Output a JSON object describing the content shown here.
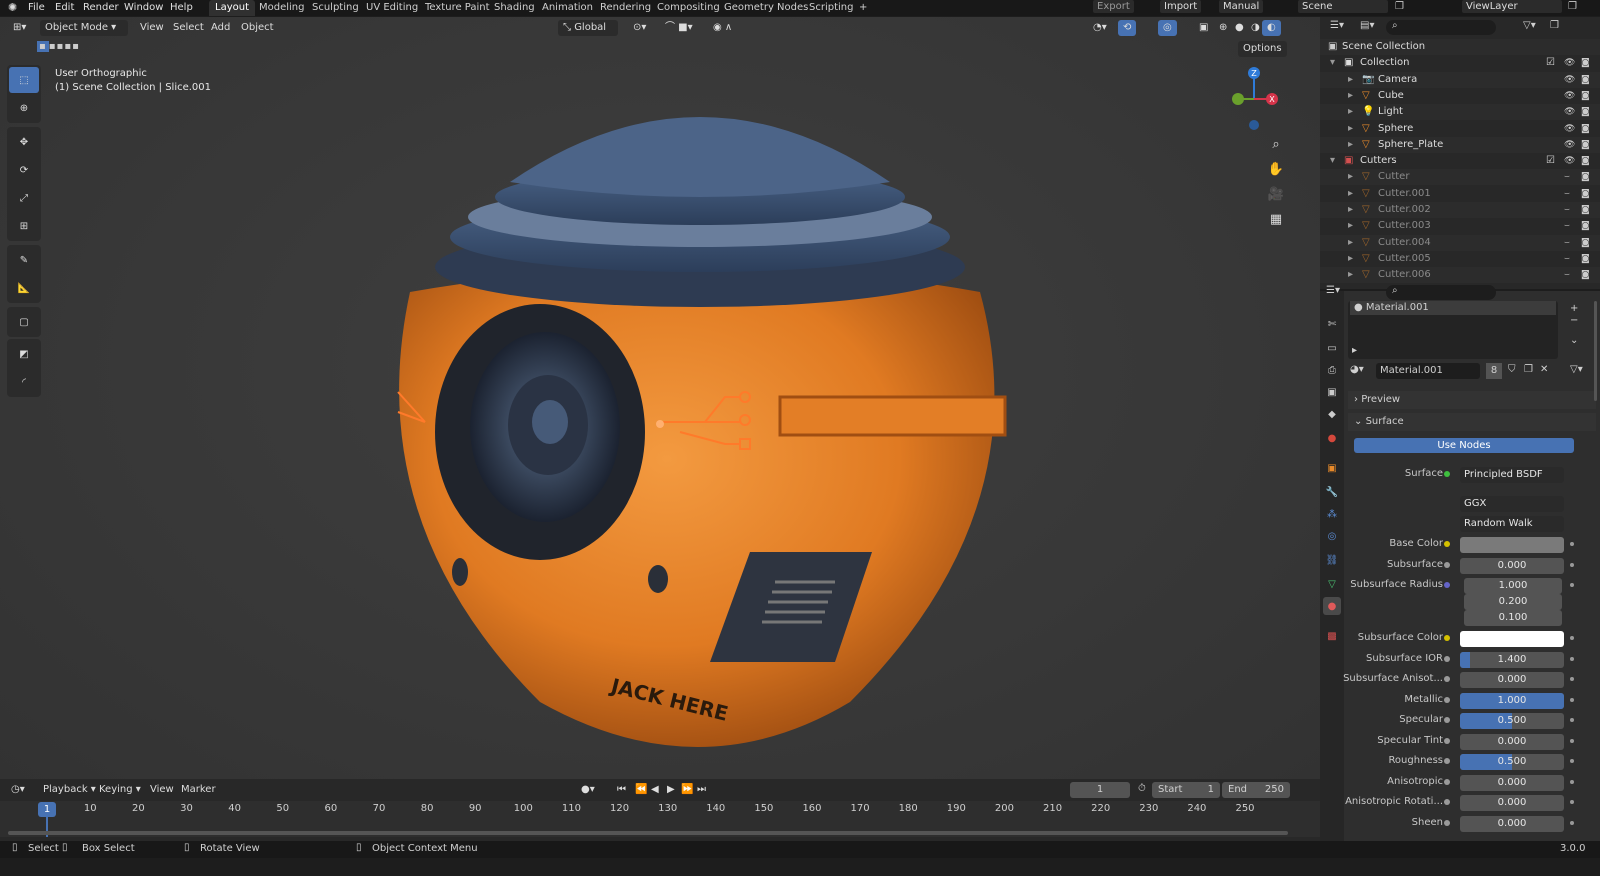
{
  "topbar": {
    "menus": [
      "File",
      "Edit",
      "Render",
      "Window",
      "Help"
    ],
    "workspaces": [
      "Layout",
      "Modeling",
      "Sculpting",
      "UV Editing",
      "Texture Paint",
      "Shading",
      "Animation",
      "Rendering",
      "Compositing",
      "Geometry Nodes",
      "Scripting"
    ],
    "add_tab": "+",
    "export": "Export",
    "import": "Import",
    "manual": "Manual",
    "scene": "Scene",
    "view_layer": "ViewLayer"
  },
  "viewport": {
    "mode": "Object Mode",
    "menus": [
      "View",
      "Select",
      "Add",
      "Object"
    ],
    "orientation": "Global",
    "options": "Options",
    "info_line1": "User Orthographic",
    "info_line2": "(1) Scene Collection | Slice.001",
    "decal_text": "JACK HERE",
    "gizmo": {
      "z": "Z",
      "x": "X"
    }
  },
  "outliner": {
    "root": "Scene Collection",
    "items": [
      {
        "name": "Collection",
        "type": "collection",
        "depth": 0
      },
      {
        "name": "Camera",
        "type": "camera",
        "depth": 1
      },
      {
        "name": "Cube",
        "type": "mesh",
        "depth": 1
      },
      {
        "name": "Light",
        "type": "light",
        "depth": 1
      },
      {
        "name": "Sphere",
        "type": "mesh",
        "depth": 1
      },
      {
        "name": "Sphere_Plate",
        "type": "mesh",
        "depth": 1
      },
      {
        "name": "Cutters",
        "type": "collection",
        "depth": 0
      },
      {
        "name": "Cutter",
        "type": "mesh",
        "depth": 1
      },
      {
        "name": "Cutter.001",
        "type": "mesh",
        "depth": 1
      },
      {
        "name": "Cutter.002",
        "type": "mesh",
        "depth": 1
      },
      {
        "name": "Cutter.003",
        "type": "mesh",
        "depth": 1
      },
      {
        "name": "Cutter.004",
        "type": "mesh",
        "depth": 1
      },
      {
        "name": "Cutter.005",
        "type": "mesh",
        "depth": 1
      },
      {
        "name": "Cutter.006",
        "type": "mesh",
        "depth": 1
      }
    ]
  },
  "properties": {
    "slot": "Material.001",
    "material_name": "Material.001",
    "users": "8",
    "preview": "Preview",
    "surface_section": "Surface",
    "use_nodes": "Use Nodes",
    "surface_label": "Surface",
    "surface_value": "Principled BSDF",
    "distribution": "GGX",
    "subsurface_method": "Random Walk",
    "fields": [
      {
        "label": "Base Color",
        "kind": "color",
        "color": "#7a7a7a",
        "dot": "#d4c000"
      },
      {
        "label": "Subsurface",
        "value": "0.000",
        "fill": 0,
        "dot": "#9a9a9a"
      },
      {
        "label": "Subsurface Radius",
        "value": "1.000",
        "fill": 0,
        "dot": "#6464c8",
        "vector": [
          "1.000",
          "0.200",
          "0.100"
        ]
      },
      {
        "label": "Subsurface Color",
        "kind": "color",
        "color": "#ffffff",
        "dot": "#d4c000"
      },
      {
        "label": "Subsurface IOR",
        "value": "1.400",
        "fill": 0.1,
        "dot": "#9a9a9a"
      },
      {
        "label": "Subsurface Anisot...",
        "value": "0.000",
        "fill": 0,
        "dot": "#9a9a9a"
      },
      {
        "label": "Metallic",
        "value": "1.000",
        "fill": 1,
        "dot": "#9a9a9a"
      },
      {
        "label": "Specular",
        "value": "0.500",
        "fill": 0.5,
        "dot": "#9a9a9a"
      },
      {
        "label": "Specular Tint",
        "value": "0.000",
        "fill": 0,
        "dot": "#9a9a9a"
      },
      {
        "label": "Roughness",
        "value": "0.500",
        "fill": 0.5,
        "dot": "#9a9a9a"
      },
      {
        "label": "Anisotropic",
        "value": "0.000",
        "fill": 0,
        "dot": "#9a9a9a"
      },
      {
        "label": "Anisotropic Rotati...",
        "value": "0.000",
        "fill": 0,
        "dot": "#9a9a9a"
      },
      {
        "label": "Sheen",
        "value": "0.000",
        "fill": 0,
        "dot": "#9a9a9a"
      }
    ]
  },
  "timeline": {
    "menus": [
      "Playback",
      "Keying",
      "View",
      "Marker"
    ],
    "current_frame": "1",
    "start_label": "Start",
    "start": "1",
    "end_label": "End",
    "end": "250",
    "ticks": [
      "1",
      "10",
      "20",
      "30",
      "40",
      "50",
      "60",
      "70",
      "80",
      "90",
      "100",
      "110",
      "120",
      "130",
      "140",
      "150",
      "160",
      "170",
      "180",
      "190",
      "200",
      "210",
      "220",
      "230",
      "240",
      "250"
    ],
    "playhead": "1"
  },
  "status": {
    "select": "Select",
    "box_select": "Box Select",
    "rotate": "Rotate View",
    "context": "Object Context Menu",
    "version": "3.0.0"
  },
  "colors": {
    "accent": "#4772b3",
    "orange": "#e8822a",
    "navy": "#3b5273",
    "glow": "#ff6a1a"
  }
}
